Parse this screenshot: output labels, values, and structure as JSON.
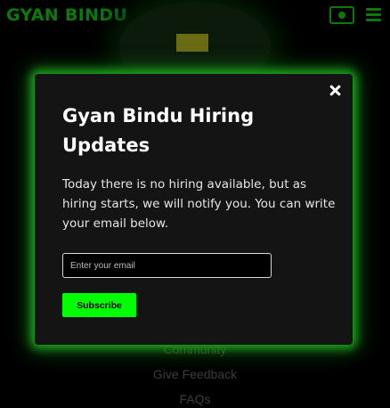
{
  "header": {
    "logo_text": "GYAN BINDU",
    "theme_icon": "sun-icon",
    "menu_icon": "hamburger-menu-icon"
  },
  "background": {
    "footer_links": [
      "Community",
      "Give Feedback",
      "FAQs"
    ]
  },
  "modal": {
    "title": "Gyan Bindu Hiring Updates",
    "message": "Today there is no hiring available, but as hiring starts, we will notify you. You can write your email below.",
    "email_placeholder": "Enter your email",
    "email_value": "",
    "subscribe_label": "Subscribe",
    "close_icon": "close-icon"
  },
  "colors": {
    "accent": "#00ff00",
    "glow": "#1fa51f",
    "logo": "#0a7a0a",
    "modal_bg": "#141414",
    "page_bg": "#000000"
  }
}
